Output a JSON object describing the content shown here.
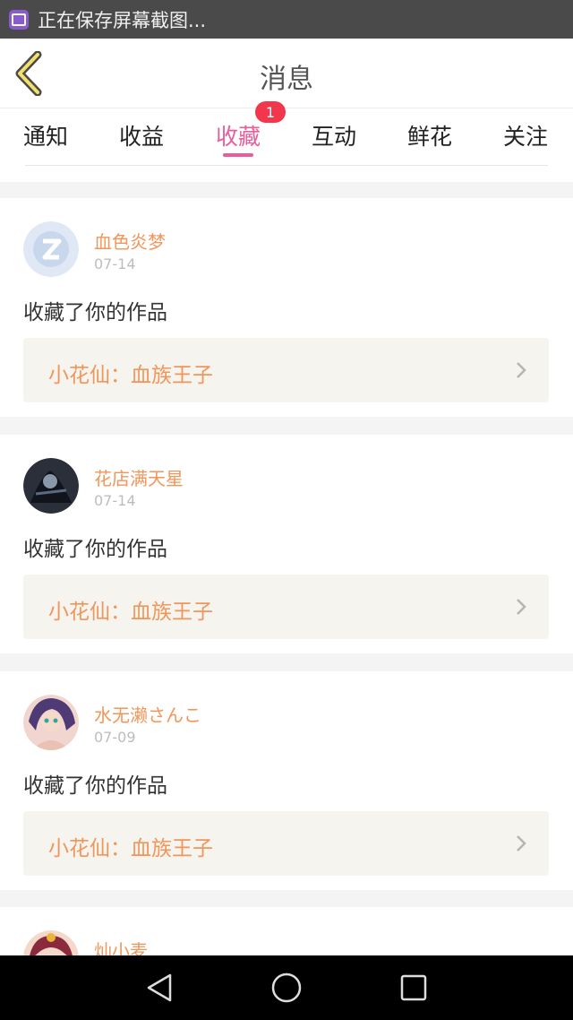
{
  "status_bar": {
    "text": "正在保存屏幕截图..."
  },
  "header": {
    "title": "消息"
  },
  "tabs": [
    {
      "label": "通知"
    },
    {
      "label": "收益"
    },
    {
      "label": "收藏",
      "badge": "1",
      "active": true
    },
    {
      "label": "互动"
    },
    {
      "label": "鲜花"
    },
    {
      "label": "关注"
    }
  ],
  "messages": [
    {
      "user": "血色炎梦",
      "date": "07-14",
      "action": "收藏了你的作品",
      "work": "小花仙：血族王子"
    },
    {
      "user": "花店满天星",
      "date": "07-14",
      "action": "收藏了你的作品",
      "work": "小花仙：血族王子"
    },
    {
      "user": "水无濑さんこ",
      "date": "07-09",
      "action": "收藏了你的作品",
      "work": "小花仙：血族王子"
    },
    {
      "user": "灿小麦"
    }
  ],
  "colors": {
    "accent": "#e85d9a",
    "name": "#f0965a",
    "badge": "#f2364b"
  }
}
